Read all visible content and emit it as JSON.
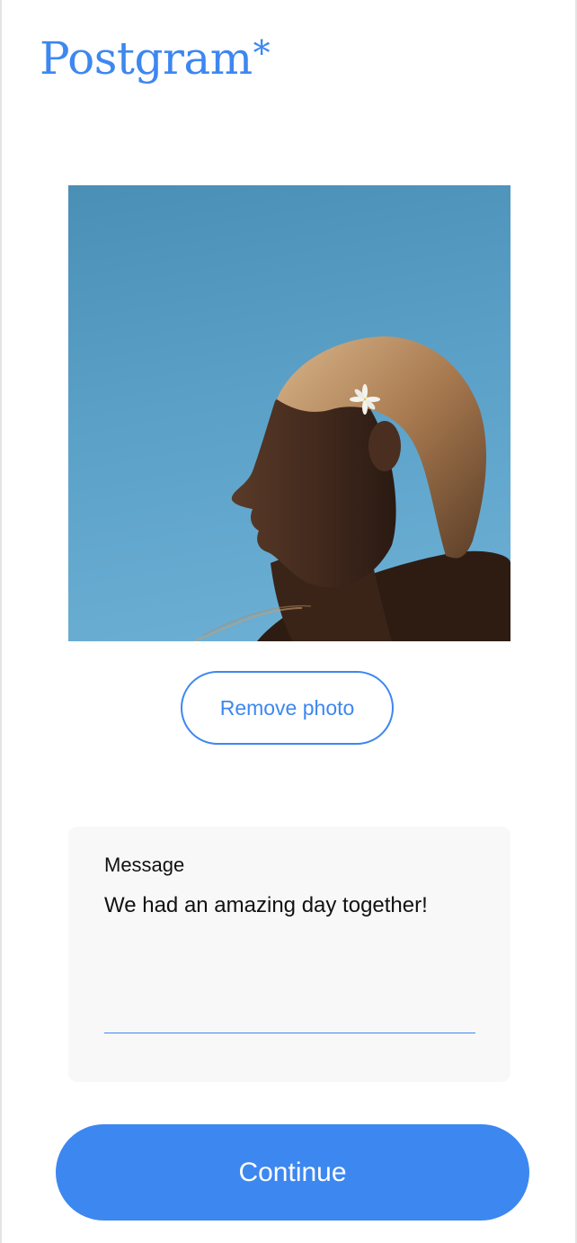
{
  "app": {
    "logo_text": "Postgram",
    "logo_mark": "*",
    "brand_color": "#3d87f0"
  },
  "photo": {
    "alt": "Woman in profile against a blue sky with a flower in her hair",
    "sky_color": "#5aa0c7"
  },
  "actions": {
    "remove_photo_label": "Remove photo",
    "continue_label": "Continue"
  },
  "message": {
    "label": "Message",
    "value": "We had an amazing day together!"
  }
}
